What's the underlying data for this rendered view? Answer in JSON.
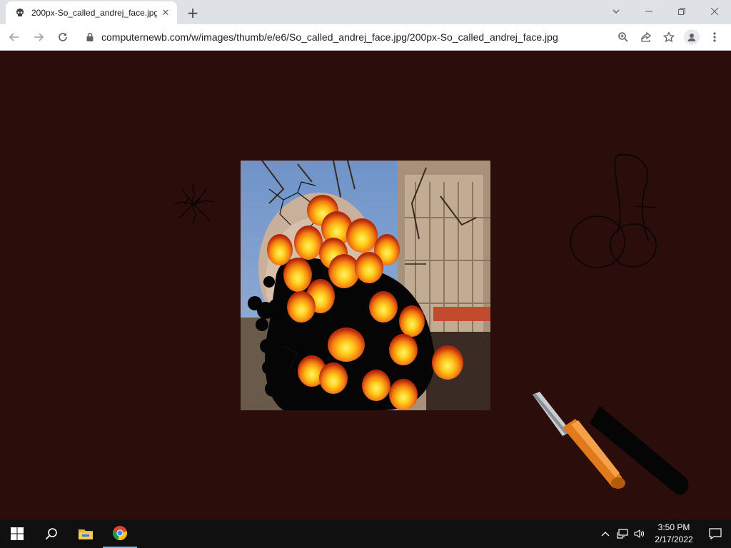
{
  "browser": {
    "tab": {
      "title": "200px-So_called_andrej_face.jpg",
      "favicon": "skull-icon"
    },
    "new_tab_label": "+",
    "url": "computernewb.com/w/images/thumb/e/e6/So_called_andrej_face.jpg/200px-So_called_andrej_face.jpg",
    "toolbar_icons": [
      "back-icon",
      "forward-icon",
      "reload-icon",
      "lock-icon",
      "zoom-icon",
      "share-icon",
      "bookmark-star-icon",
      "profile-icon",
      "menu-icon"
    ],
    "window_controls": [
      "minimize-icon",
      "restore-icon",
      "close-icon"
    ]
  },
  "page": {
    "background": "#2b0d0c",
    "image_alt": "200px-So_called_andrej_face.jpg"
  },
  "taskbar": {
    "items": [
      "windows-start-icon",
      "search-icon",
      "file-explorer-icon",
      "chrome-icon"
    ],
    "tray_icons": [
      "chevron-up-icon",
      "network-icon",
      "volume-icon"
    ],
    "time": "3:50 PM",
    "date": "2/17/2022",
    "notification_icon": "notification-icon"
  }
}
